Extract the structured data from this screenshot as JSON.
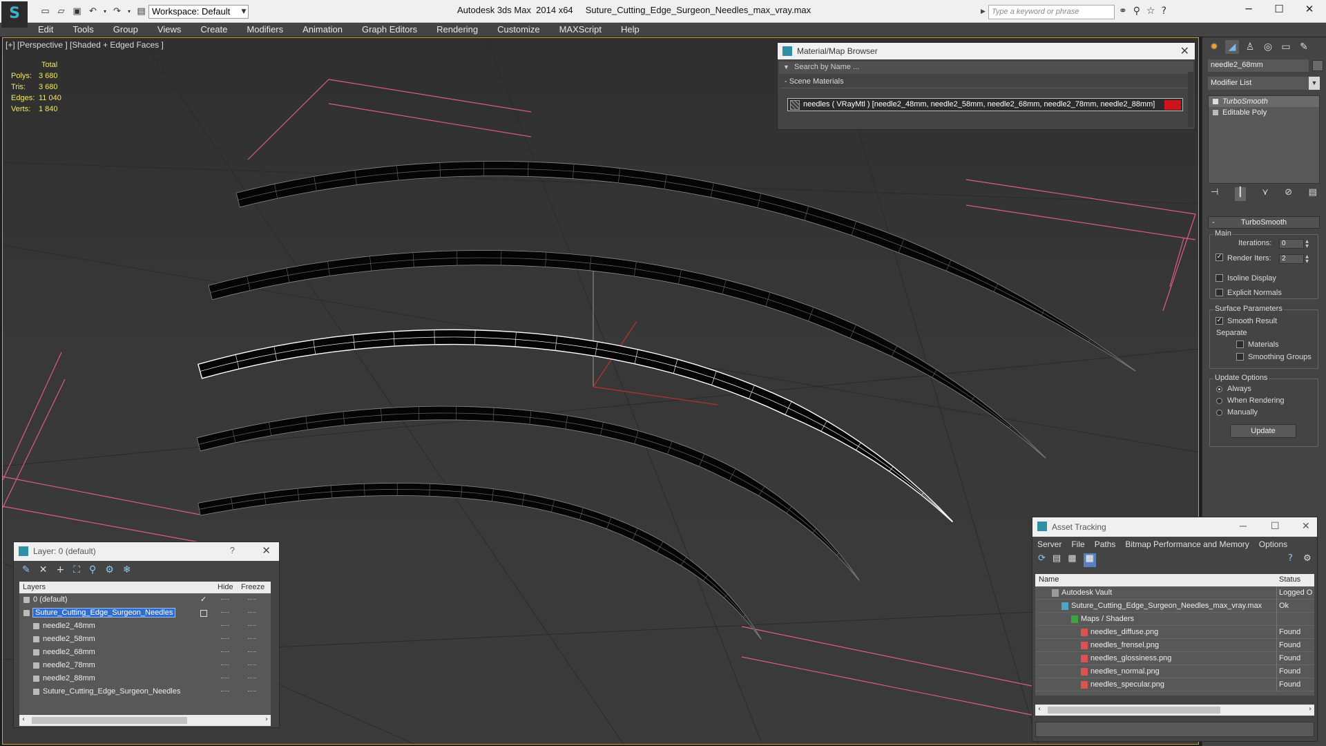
{
  "titlebar": {
    "workspace": "Workspace: Default",
    "app_title": "Autodesk 3ds Max  2014 x64     Suture_Cutting_Edge_Surgeon_Needles_max_vray.max",
    "search_placeholder": "Type a keyword or phrase",
    "window_controls": {
      "minimize": "─",
      "maximize": "☐",
      "close": "✕"
    }
  },
  "menu": [
    "Edit",
    "Tools",
    "Group",
    "Views",
    "Create",
    "Modifiers",
    "Animation",
    "Graph Editors",
    "Rendering",
    "Customize",
    "MAXScript",
    "Help"
  ],
  "viewport": {
    "label": "[+] [Perspective ] [Shaded + Edged Faces ]",
    "stats": {
      "total_label": "Total",
      "rows": [
        {
          "key": "Polys:",
          "value": "3 680"
        },
        {
          "key": "Tris:",
          "value": "3 680"
        },
        {
          "key": "Edges:",
          "value": "11 040"
        },
        {
          "key": "Verts:",
          "value": "1 840"
        }
      ]
    },
    "colors": {
      "accent_border": "#d4a230",
      "stats_text": "#f4e85e",
      "grid_pink": "#e05a8a"
    }
  },
  "material_browser": {
    "title": "Material/Map Browser",
    "search_placeholder": "Search by Name ...",
    "section": "- Scene Materials",
    "item": "needles  ( VRayMtl ) [needle2_48mm, needle2_58mm, needle2_68mm, needle2_78mm, needle2_88mm]",
    "swatch_color": "#d0141c"
  },
  "command_panel": {
    "object_name": "needle2_68mm",
    "modifier_list": "Modifier List",
    "stack": [
      {
        "label": "TurboSmooth",
        "selected": true
      },
      {
        "label": "Editable Poly",
        "selected": false
      }
    ],
    "rollout_title": "TurboSmooth",
    "main_group": "Main",
    "iterations_label": "Iterations:",
    "iterations_value": "0",
    "render_iters_label": "Render Iters:",
    "render_iters_value": "2",
    "render_iters_checked": true,
    "isoline_label": "Isoline Display",
    "explicit_normals_label": "Explicit Normals",
    "surface_group": "Surface Parameters",
    "smooth_result_label": "Smooth Result",
    "separate_label": "Separate",
    "materials_label": "Materials",
    "smoothing_groups_label": "Smoothing Groups",
    "update_group": "Update Options",
    "update_options": [
      "Always",
      "When Rendering",
      "Manually"
    ],
    "update_selected": "Always",
    "update_button": "Update"
  },
  "layer_dialog": {
    "title": "Layer: 0 (default)",
    "help": "?",
    "headers": {
      "layers": "Layers",
      "hide": "Hide",
      "freeze": "Freeze"
    },
    "rows": [
      {
        "name": "0 (default)",
        "indent": 0,
        "selected": false,
        "active": true
      },
      {
        "name": "Suture_Cutting_Edge_Surgeon_Needles",
        "indent": 0,
        "selected": true,
        "active": false
      },
      {
        "name": "needle2_48mm",
        "indent": 1,
        "selected": false,
        "active": false
      },
      {
        "name": "needle2_58mm",
        "indent": 1,
        "selected": false,
        "active": false
      },
      {
        "name": "needle2_68mm",
        "indent": 1,
        "selected": false,
        "active": false
      },
      {
        "name": "needle2_78mm",
        "indent": 1,
        "selected": false,
        "active": false
      },
      {
        "name": "needle2_88mm",
        "indent": 1,
        "selected": false,
        "active": false
      },
      {
        "name": "Suture_Cutting_Edge_Surgeon_Needles",
        "indent": 1,
        "selected": false,
        "active": false
      }
    ]
  },
  "asset_tracking": {
    "title": "Asset Tracking",
    "menu": [
      "Server",
      "File",
      "Paths",
      "Bitmap Performance and Memory",
      "Options"
    ],
    "headers": {
      "name": "Name",
      "status": "Status"
    },
    "rows": [
      {
        "name": "Autodesk Vault",
        "status": "Logged O",
        "indent": 1,
        "icon": "vault"
      },
      {
        "name": "Suture_Cutting_Edge_Surgeon_Needles_max_vray.max",
        "status": "Ok",
        "indent": 2,
        "icon": "max"
      },
      {
        "name": "Maps / Shaders",
        "status": "",
        "indent": 3,
        "icon": "maps"
      },
      {
        "name": "needles_diffuse.png",
        "status": "Found",
        "indent": 4,
        "icon": "png"
      },
      {
        "name": "needles_frensel.png",
        "status": "Found",
        "indent": 4,
        "icon": "png"
      },
      {
        "name": "needles_glossiness.png",
        "status": "Found",
        "indent": 4,
        "icon": "png"
      },
      {
        "name": "needles_normal.png",
        "status": "Found",
        "indent": 4,
        "icon": "png"
      },
      {
        "name": "needles_specular.png",
        "status": "Found",
        "indent": 4,
        "icon": "png"
      }
    ]
  }
}
